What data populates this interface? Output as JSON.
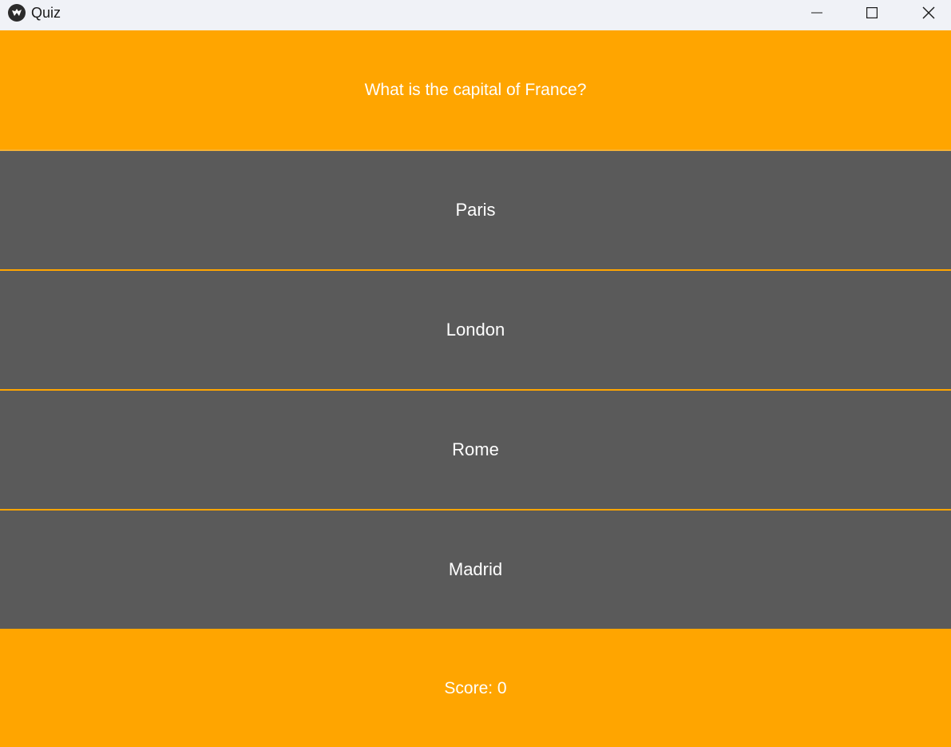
{
  "window": {
    "title": "Quiz",
    "icon": "kivy-logo-icon",
    "controls": [
      "minimize-icon",
      "maximize-icon",
      "close-icon"
    ]
  },
  "question": {
    "text": "What is the capital of France?"
  },
  "answers": [
    {
      "label": "Paris"
    },
    {
      "label": "London"
    },
    {
      "label": "Rome"
    },
    {
      "label": "Madrid"
    }
  ],
  "score": {
    "text": "Score: 0"
  },
  "colors": {
    "accent": "#ffa500",
    "button": "#5a5a5a",
    "text": "#ffffff",
    "titlebar": "#f0f2f7"
  }
}
